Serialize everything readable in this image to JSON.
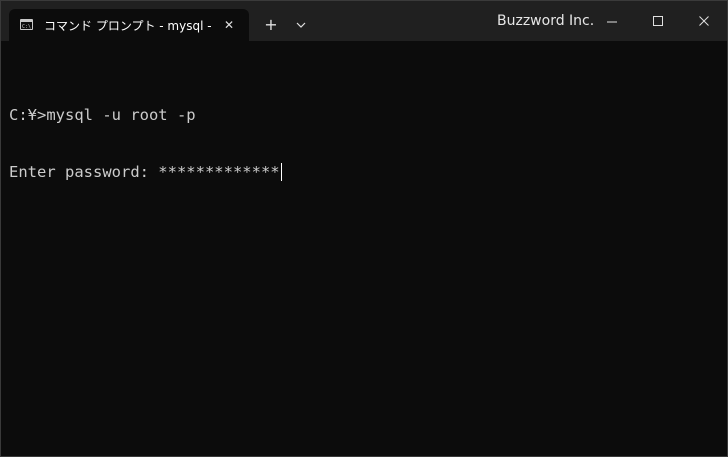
{
  "tab": {
    "title": "コマンド プロンプト - mysql  -u root -p",
    "icon": "command-prompt-icon",
    "close_icon": "close-icon"
  },
  "titlebar": {
    "brand": "Buzzword Inc.",
    "new_tab_icon": "plus-icon",
    "dropdown_icon": "chevron-down-icon",
    "minimize_icon": "minimize-icon",
    "maximize_icon": "maximize-icon",
    "close_icon": "close-icon"
  },
  "console": {
    "lines": [
      "C:¥>mysql -u root -p",
      "Enter password: *************"
    ]
  },
  "colors": {
    "background": "#0c0c0c",
    "titlebar": "#202020",
    "text": "#cccccc"
  }
}
